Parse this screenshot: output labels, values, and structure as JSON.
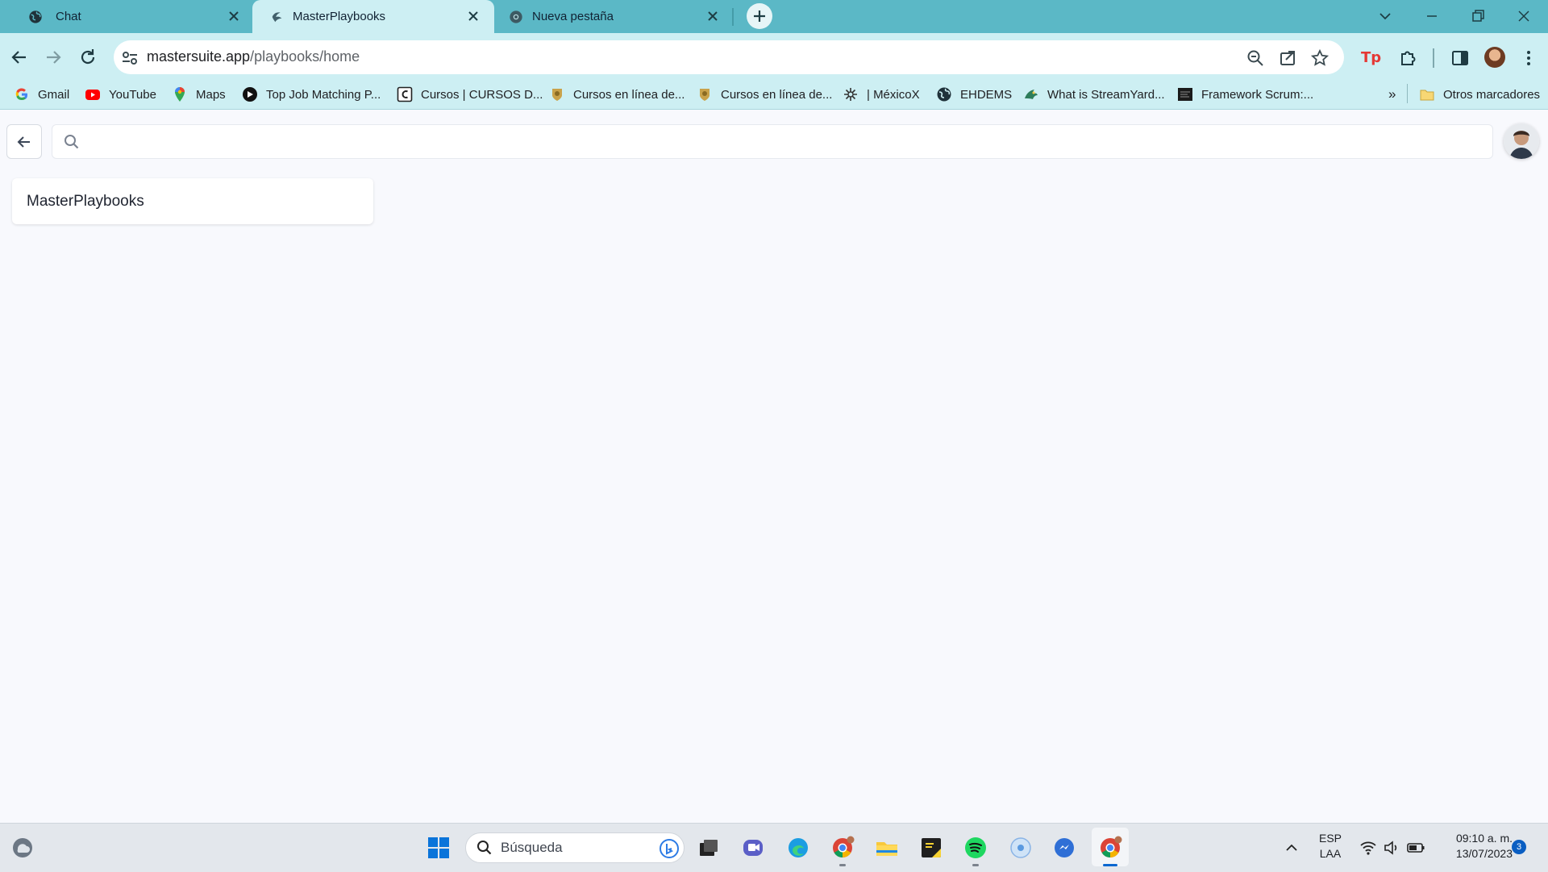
{
  "browser": {
    "tabs": [
      {
        "title": "Chat",
        "favicon": "globe-icon",
        "active": false
      },
      {
        "title": "MasterPlaybooks",
        "favicon": "masterplaybooks-icon",
        "active": true
      },
      {
        "title": "Nueva pestaña",
        "favicon": "chrome-icon",
        "active": false
      }
    ],
    "url_host": "mastersuite.app",
    "url_path": "/playbooks/home",
    "colors": {
      "tabstrip": "#5bb8c6",
      "toolbar": "#cdeff3",
      "accent": "#e53935"
    },
    "bookmarks": [
      {
        "label": "Gmail",
        "icon": "google-icon"
      },
      {
        "label": "YouTube",
        "icon": "youtube-icon"
      },
      {
        "label": "Maps",
        "icon": "maps-pin-icon"
      },
      {
        "label": "Top Job Matching P...",
        "icon": "jobs-icon"
      },
      {
        "label": "Cursos | CURSOS D...",
        "icon": "cursos-icon"
      },
      {
        "label": "Cursos en línea de...",
        "icon": "unam-icon"
      },
      {
        "label": "Cursos en línea de...",
        "icon": "unam-icon"
      },
      {
        "label": "| MéxicoX",
        "icon": "mexicox-icon"
      },
      {
        "label": "EHDEMS",
        "icon": "globe-icon"
      },
      {
        "label": "What is StreamYard...",
        "icon": "streamyard-icon"
      },
      {
        "label": "Framework Scrum:...",
        "icon": "scrum-icon"
      }
    ],
    "bookmarks_overflow": "»",
    "other_bookmarks": "Otros marcadores"
  },
  "page": {
    "search_placeholder": "",
    "card_title": "MasterPlaybooks"
  },
  "taskbar": {
    "search_label": "Búsqueda",
    "language_line1": "ESP",
    "language_line2": "LAA",
    "time": "09:10 a. m.",
    "date": "13/07/2023",
    "notification_count": "3"
  }
}
